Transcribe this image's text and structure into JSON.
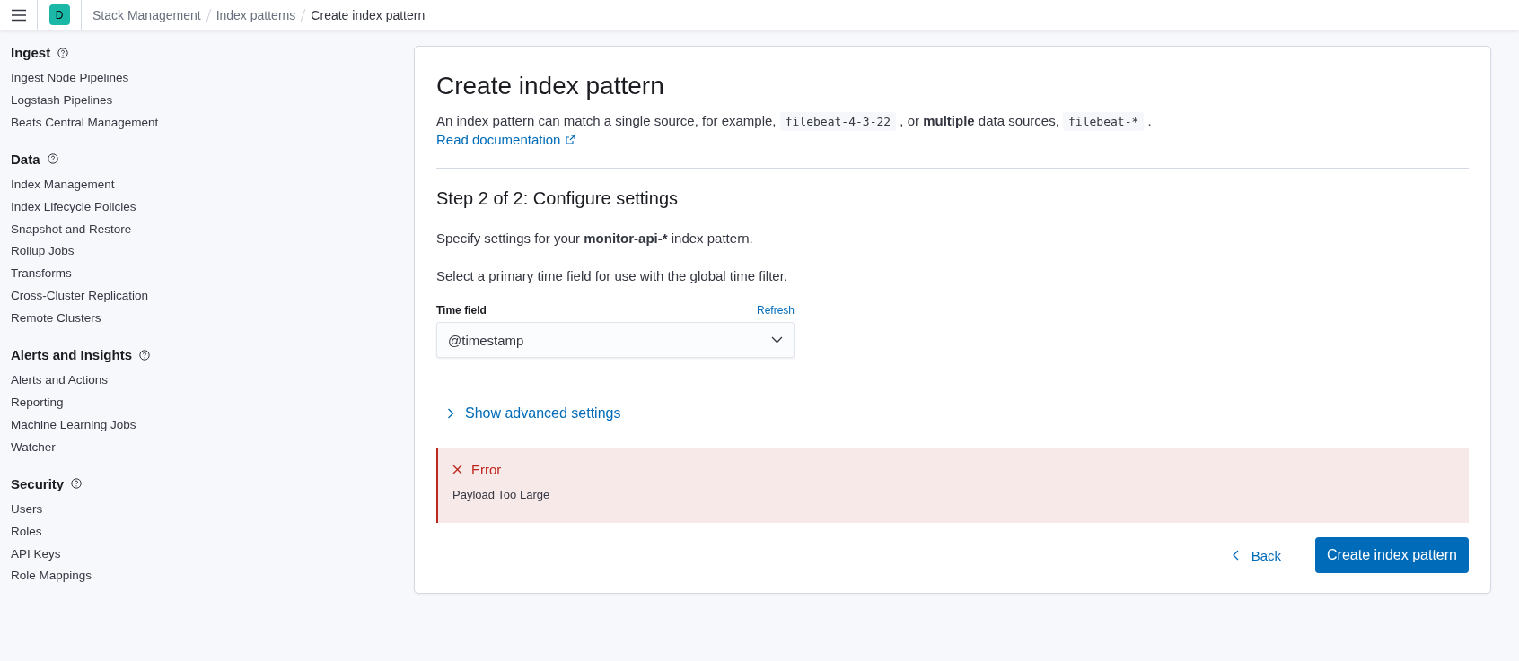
{
  "header": {
    "avatar": "D",
    "breadcrumbs": [
      {
        "label": "Stack Management",
        "current": false
      },
      {
        "label": "Index patterns",
        "current": false
      },
      {
        "label": "Create index pattern",
        "current": true
      }
    ]
  },
  "sidebar": {
    "sections": [
      {
        "title": "Ingest",
        "items": [
          "Ingest Node Pipelines",
          "Logstash Pipelines",
          "Beats Central Management"
        ]
      },
      {
        "title": "Data",
        "items": [
          "Index Management",
          "Index Lifecycle Policies",
          "Snapshot and Restore",
          "Rollup Jobs",
          "Transforms",
          "Cross-Cluster Replication",
          "Remote Clusters"
        ]
      },
      {
        "title": "Alerts and Insights",
        "items": [
          "Alerts and Actions",
          "Reporting",
          "Machine Learning Jobs",
          "Watcher"
        ]
      },
      {
        "title": "Security",
        "items": [
          "Users",
          "Roles",
          "API Keys",
          "Role Mappings"
        ]
      }
    ]
  },
  "page": {
    "title": "Create index pattern",
    "description": [
      {
        "kind": "text",
        "text": "An index pattern can match a single source, for example, "
      },
      {
        "kind": "code",
        "text": "filebeat-4-3-22"
      },
      {
        "kind": "text",
        "text": " , or "
      },
      {
        "kind": "bold",
        "text": "multiple"
      },
      {
        "kind": "text",
        "text": " data sources, "
      },
      {
        "kind": "code",
        "text": "filebeat-*"
      },
      {
        "kind": "text",
        "text": " ."
      }
    ],
    "doc_link": "Read documentation",
    "step_title": "Step 2 of 2: Configure settings",
    "specify": [
      {
        "kind": "text",
        "text": "Specify settings for your "
      },
      {
        "kind": "bold",
        "text": "monitor-api-*"
      },
      {
        "kind": "text",
        "text": " index pattern."
      }
    ],
    "select_hint": "Select a primary time field for use with the global time filter.",
    "time_field": {
      "label": "Time field",
      "refresh": "Refresh",
      "value": "@timestamp"
    },
    "advanced": {
      "label": "Show advanced settings",
      "expanded": false
    },
    "error": {
      "title": "Error",
      "message": "Payload Too Large"
    },
    "buttons": {
      "back": "Back",
      "create": "Create index pattern"
    }
  }
}
